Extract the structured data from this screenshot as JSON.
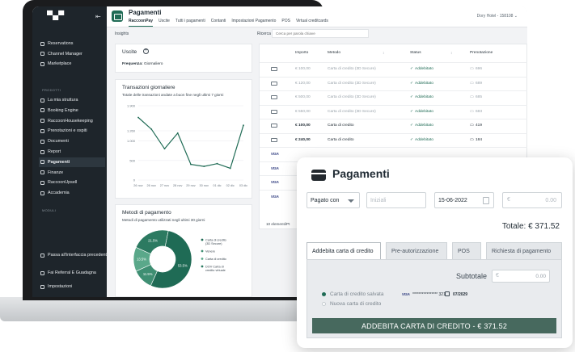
{
  "header": {
    "title": "Pagamenti",
    "hotel_selector": "Dory Hotel - 158108 ⌄",
    "tabs": [
      "RaccoonPay",
      "Uscite",
      "Tutti i pagamenti",
      "Contanti",
      "Impostazioni Pagamento",
      "POS",
      "Virtual creditcards"
    ]
  },
  "sidebar": {
    "items_top": [
      "Reservations",
      "Channel Manager",
      "Marketplace"
    ],
    "section_1": "PRODOTTI",
    "items_products": [
      "La mia struttura",
      "Booking Engine",
      "RaccoonHousekeeping",
      "Prenotazioni e ospiti",
      "Documenti",
      "Report",
      "Pagamenti",
      "Finanze",
      "RaccoonUpsell",
      "Accademia"
    ],
    "section_2": "MODULI",
    "items_bottom": [
      "Passa all'interfaccia precedente",
      "Fai Referral E Guadagna",
      "Impostazioni"
    ],
    "active": "Pagamenti"
  },
  "insights_label": "Insights",
  "search": {
    "label": "Ricerca",
    "placeholder": "Cerca per parola chiave"
  },
  "uscite": {
    "title": "Uscite",
    "frequency_label": "Frequenza:",
    "frequency_value": "Giornaliero"
  },
  "transactions": {
    "title": "Transazioni giornaliere",
    "subtitle": "Totale delle transazioni andate a buon fine negli ultimi 7 giorni"
  },
  "methods": {
    "title": "Metodi di pagamento",
    "subtitle": "Metodi di pagamento utilizzati negli ultimi 30 giorni"
  },
  "chart_data": [
    {
      "type": "line",
      "title": "Transazioni giornaliere",
      "x": [
        "26 nov",
        "26 nov",
        "27 nov",
        "28 nov",
        "29 nov",
        "30 nov",
        "01 dic",
        "02 dic",
        "03 dic"
      ],
      "y": [
        1600,
        1300,
        800,
        1200,
        400,
        350,
        420,
        300,
        1400
      ],
      "yticks": [
        "1.900",
        "1.260",
        "1.000",
        "500",
        "0"
      ],
      "ylim": [
        0,
        1900
      ],
      "grid": true,
      "color": "#1f6b55"
    },
    {
      "type": "pie",
      "title": "Metodi di pagamento",
      "slices": [
        {
          "label": "Carta di credito (3D Secure)",
          "value": 53.5,
          "color": "#1f6b55"
        },
        {
          "label": "Venere",
          "value": 11.5,
          "color": "#3f8f73"
        },
        {
          "label": "Carta di credito",
          "value": 13.5,
          "color": "#5aa88a"
        },
        {
          "label": "DOV Carta di credito virtuale",
          "value": 21.5,
          "color": "#2c7a61"
        }
      ],
      "slice_labels": [
        "53.5%",
        "11.5%",
        "13.5%",
        "21.5%"
      ],
      "legend": "right"
    }
  ],
  "table": {
    "headers": [
      "Importo",
      "Metodo",
      "Status",
      "Prenotazione"
    ],
    "rows": [
      {
        "icon": "card",
        "amount": "€ 100,00",
        "method": "Carta di credito (3D Secure)",
        "status": "Addebitato",
        "booking": "696",
        "dim": true
      },
      {
        "icon": "card",
        "amount": "€ 120,00",
        "method": "Carta di credito (3D Secure)",
        "status": "Addebitato",
        "booking": "689",
        "dim": true
      },
      {
        "icon": "card",
        "amount": "€ 500,00",
        "method": "Carta di credito (3D Secure)",
        "status": "Addebitato",
        "booking": "685",
        "dim": true
      },
      {
        "icon": "card",
        "amount": "€ 550,00",
        "method": "Carta di credito (3D Secure)",
        "status": "Addebitato",
        "booking": "683",
        "dim": true
      },
      {
        "icon": "card",
        "amount": "€ 100,00",
        "method": "Carta di credito",
        "status": "Addebitato",
        "booking": "419",
        "dim": false
      },
      {
        "icon": "card",
        "amount": "€ 240,00",
        "method": "Carta di credito",
        "status": "Addebitato",
        "booking": "184",
        "dim": false
      },
      {
        "icon": "visa",
        "amount": "",
        "method": "",
        "status": "",
        "booking": "",
        "dim": false
      },
      {
        "icon": "visa",
        "amount": "",
        "method": "",
        "status": "",
        "booking": "",
        "dim": false
      },
      {
        "icon": "visa",
        "amount": "",
        "method": "",
        "status": "",
        "booking": "",
        "dim": false
      },
      {
        "icon": "visa",
        "amount": "",
        "method": "",
        "status": "",
        "booking": "",
        "dim": false
      }
    ],
    "footer": "10 elementi/Pt"
  },
  "modal": {
    "title": "Pagamenti",
    "paid_with": "Pagato con",
    "initials_placeholder": "Iniziali",
    "date": "15-06-2022",
    "amount_placeholder": "0.00",
    "total": "Totale: € 371.52",
    "tabs": [
      "Addebita carta di credito",
      "Pre-autorizzazione",
      "POS",
      "Richiesta di pagamento"
    ],
    "active_tab": "Addebita carta di credito",
    "subtotal_label": "Subtotale",
    "subtotal_placeholder": "0.00",
    "saved_card_label": "Carta di credito salvata",
    "new_card_label": "Nuova carta di credito",
    "card_number": "**************** 321",
    "card_expiry": "07/2029",
    "charge_button": "ADDEBITA CARTA DI CREDITO - € 371.52",
    "visa_brand": "VISA",
    "currency_symbol": "€"
  }
}
